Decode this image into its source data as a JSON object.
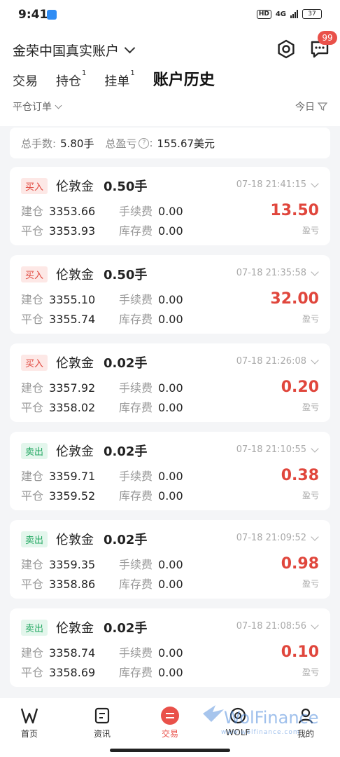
{
  "status": {
    "time": "9:41",
    "hd": "HD",
    "net": "4G",
    "battery": "37"
  },
  "header": {
    "account_title": "金荣中国真实账户",
    "badge_count": "99",
    "tabs": [
      {
        "label": "交易",
        "count": ""
      },
      {
        "label": "持仓",
        "count": "1"
      },
      {
        "label": "挂单",
        "count": "1"
      },
      {
        "label": "账户历史",
        "count": ""
      }
    ],
    "filter_label": "平仓订单",
    "date_filter": "今日"
  },
  "summary": {
    "lots_label": "总手数:",
    "lots_value": "5.80手",
    "pl_label": "总盈亏",
    "pl_value": "155.67美元"
  },
  "labels": {
    "open": "建仓",
    "close": "平仓",
    "fee": "手续费",
    "swap": "库存费",
    "pl": "盈亏"
  },
  "orders": [
    {
      "side": "买入",
      "side_type": "buy",
      "symbol": "伦敦金",
      "lots": "0.50手",
      "time": "07-18 21:41:15",
      "open": "3353.66",
      "close": "3353.93",
      "fee": "0.00",
      "swap": "0.00",
      "pl": "13.50"
    },
    {
      "side": "买入",
      "side_type": "buy",
      "symbol": "伦敦金",
      "lots": "0.50手",
      "time": "07-18 21:35:58",
      "open": "3355.10",
      "close": "3355.74",
      "fee": "0.00",
      "swap": "0.00",
      "pl": "32.00"
    },
    {
      "side": "买入",
      "side_type": "buy",
      "symbol": "伦敦金",
      "lots": "0.02手",
      "time": "07-18 21:26:08",
      "open": "3357.92",
      "close": "3358.02",
      "fee": "0.00",
      "swap": "0.00",
      "pl": "0.20"
    },
    {
      "side": "卖出",
      "side_type": "sell",
      "symbol": "伦敦金",
      "lots": "0.02手",
      "time": "07-18 21:10:55",
      "open": "3359.71",
      "close": "3359.52",
      "fee": "0.00",
      "swap": "0.00",
      "pl": "0.38"
    },
    {
      "side": "卖出",
      "side_type": "sell",
      "symbol": "伦敦金",
      "lots": "0.02手",
      "time": "07-18 21:09:52",
      "open": "3359.35",
      "close": "3358.86",
      "fee": "0.00",
      "swap": "0.00",
      "pl": "0.98"
    },
    {
      "side": "卖出",
      "side_type": "sell",
      "symbol": "伦敦金",
      "lots": "0.02手",
      "time": "07-18 21:08:56",
      "open": "3358.74",
      "close": "3358.69",
      "fee": "0.00",
      "swap": "0.00",
      "pl": "0.10"
    }
  ],
  "nav": {
    "items": [
      {
        "label": "首页",
        "icon": "home-logo-icon"
      },
      {
        "label": "资讯",
        "icon": "news-icon"
      },
      {
        "label": "交易",
        "icon": "trade-icon"
      },
      {
        "label": "WOLF",
        "icon": "wolf-icon"
      },
      {
        "label": "我的",
        "icon": "profile-icon"
      }
    ]
  },
  "watermark": {
    "text": "WolFinance",
    "url": "www.wolfinance.com"
  },
  "colors": {
    "accent": "#e9514a",
    "buy": "#e0463c",
    "sell": "#23a862"
  }
}
